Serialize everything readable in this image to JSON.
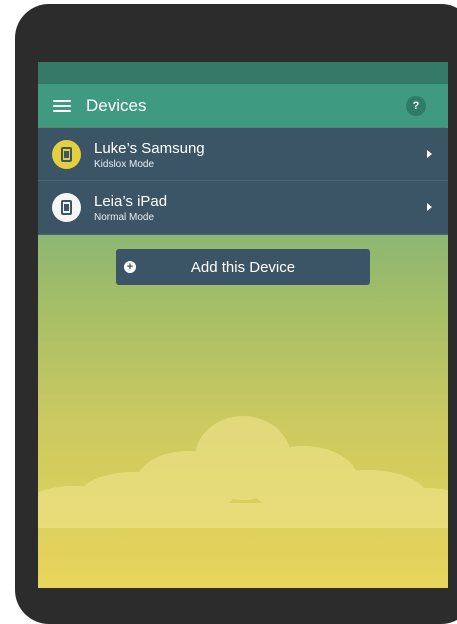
{
  "app_bar": {
    "title": "Devices",
    "help_label": "?"
  },
  "devices": [
    {
      "name": "Luke’s Samsung",
      "mode": "Kidslox Mode",
      "icon": "phone-icon",
      "icon_color": "#e6cf3f"
    },
    {
      "name": "Leia’s iPad",
      "mode": "Normal Mode",
      "icon": "tablet-icon",
      "icon_color": "#f5f5f5"
    }
  ],
  "add_device": {
    "label": "Add this Device",
    "icon": "plus-circle-icon"
  },
  "colors": {
    "app_bar": "#3f9a7f",
    "list_row": "#3b5566",
    "background_top": "#5fa58a",
    "background_bottom": "#e8d55b"
  }
}
